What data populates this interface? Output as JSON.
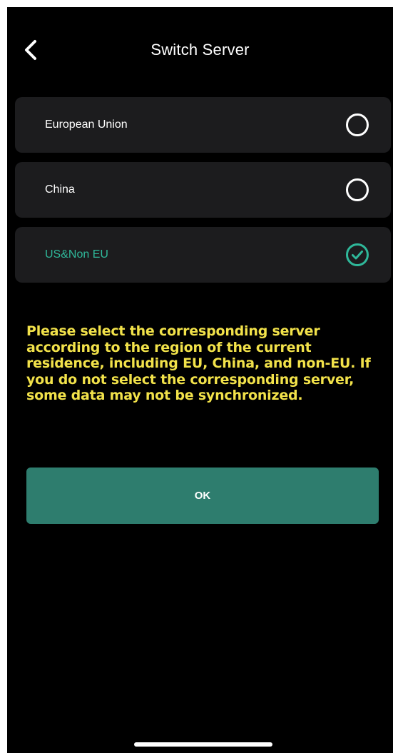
{
  "header": {
    "title": "Switch Server",
    "back_icon": "chevron-left-icon"
  },
  "servers": [
    {
      "label": "European Union",
      "selected": false
    },
    {
      "label": "China",
      "selected": false
    },
    {
      "label": "US&Non EU",
      "selected": true
    }
  ],
  "notice": "Please select the corresponding server according to the region of the current residence, including EU, China, and non-EU. If you do not select the corresponding server, some data may not be synchronized.",
  "ok_button": {
    "label": "OK"
  },
  "colors": {
    "background": "#000000",
    "card": "#1c1c1e",
    "accent": "#2fb89a",
    "button": "#2e7d6e",
    "notice": "#f2e24a"
  }
}
